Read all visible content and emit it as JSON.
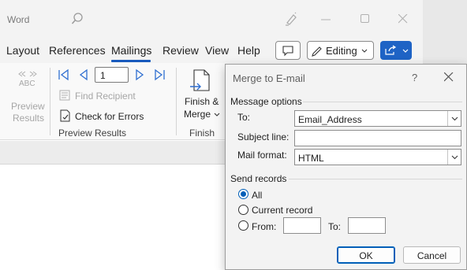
{
  "app": {
    "title": "Word"
  },
  "tabs": [
    {
      "label": "Layout"
    },
    {
      "label": "References"
    },
    {
      "label": "Mailings"
    },
    {
      "label": "Review"
    },
    {
      "label": "View"
    },
    {
      "label": "Help"
    }
  ],
  "editing_button": {
    "label": "Editing"
  },
  "ribbon": {
    "preview_results_icon_text": "ABC",
    "preview_results_label_1": "Preview",
    "preview_results_label_2": "Results",
    "record_number": "1",
    "find_recipient": "Find Recipient",
    "check_errors": "Check for Errors",
    "preview_group_label": "Preview Results",
    "finish_merge_label_1": "Finish &",
    "finish_merge_label_2": "Merge",
    "finish_group_label": "Finish"
  },
  "dialog": {
    "title": "Merge to E-mail",
    "help": "?",
    "message_options": "Message options",
    "to_label": "To:",
    "to_value": "Email_Address",
    "subject_label": "Subject line:",
    "subject_value": "",
    "format_label": "Mail format:",
    "format_value": "HTML",
    "send_records": "Send records",
    "all_label": "All",
    "current_label": "Current record",
    "from_label": "From:",
    "from_value": "",
    "to2_label": "To:",
    "to2_value": "",
    "ok": "OK",
    "cancel": "Cancel",
    "selected_record_option": "All"
  },
  "colors": {
    "accent": "#185abd",
    "share_button": "#1e63c5",
    "radio_selected": "#005fb8"
  }
}
